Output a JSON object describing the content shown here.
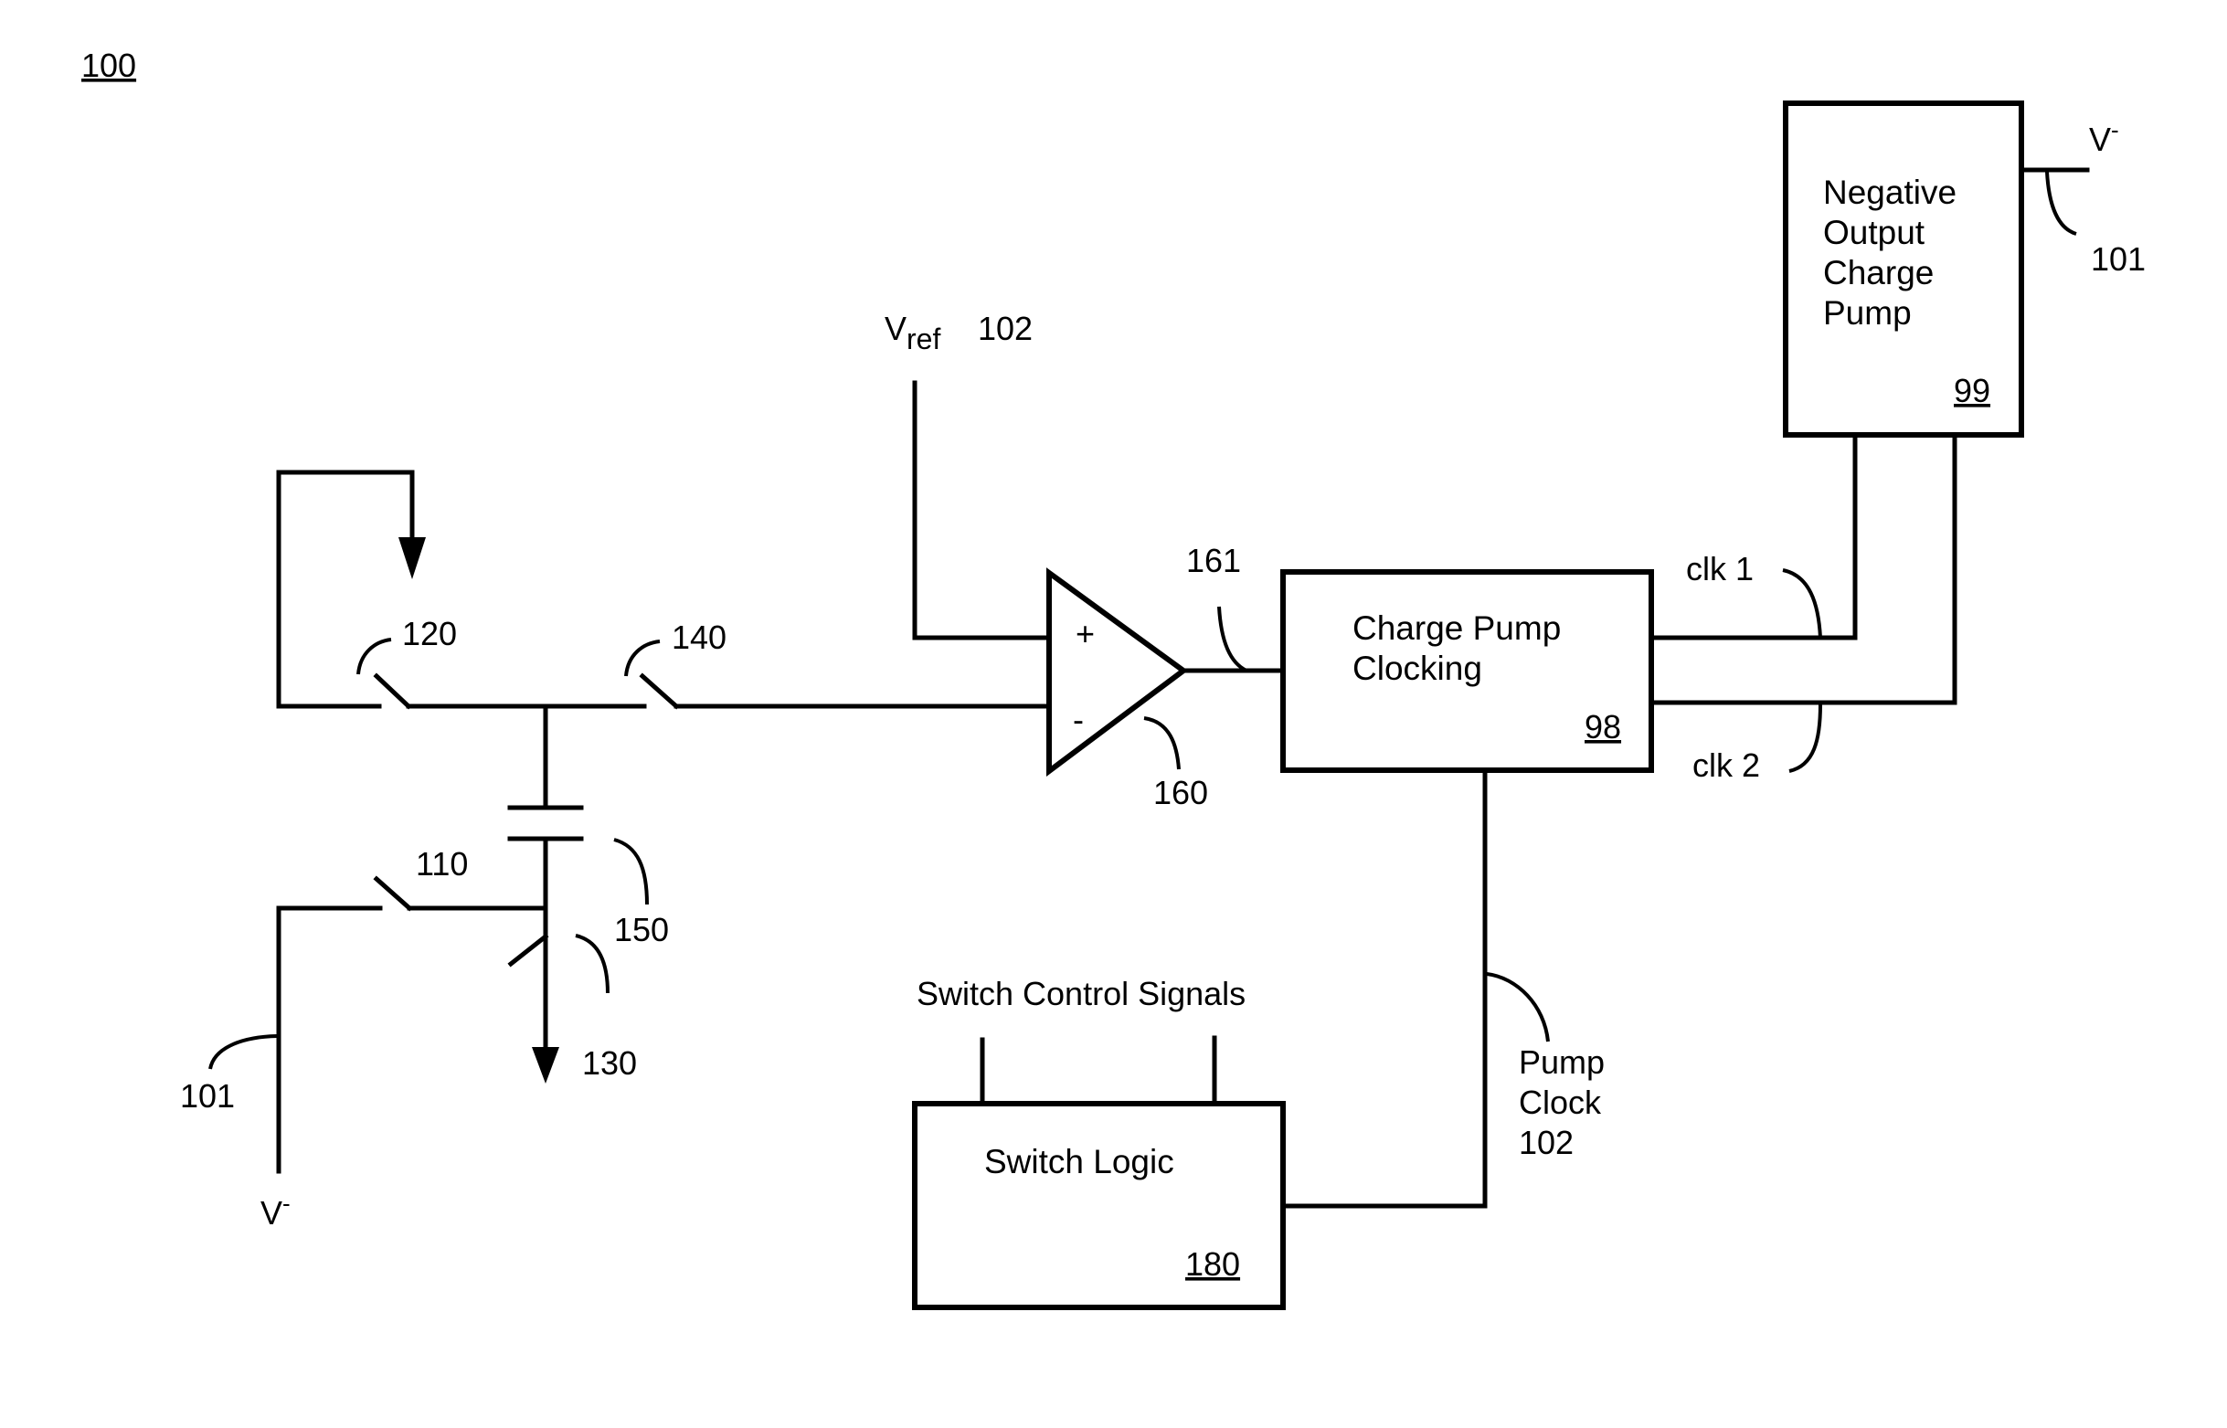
{
  "figure": {
    "ref": "100",
    "nodes": {
      "neg_pump": {
        "lines": [
          "Negative",
          "Output",
          "Charge",
          "Pump"
        ],
        "ref": "99"
      },
      "cp_clocking": {
        "lines": [
          "Charge Pump",
          "Clocking"
        ],
        "ref": "98"
      },
      "switch_logic": {
        "title": "Switch Logic",
        "ref": "180"
      },
      "comparator": {
        "ref": "160",
        "plus": "+",
        "minus": "-",
        "output_ref": "161"
      },
      "capacitor": {
        "ref": "150"
      }
    },
    "switches": [
      {
        "id": "sw120",
        "ref": "120"
      },
      {
        "id": "sw140",
        "ref": "140"
      },
      {
        "id": "sw110",
        "ref": "110"
      },
      {
        "id": "sw130",
        "ref": "130"
      }
    ],
    "labels": {
      "vref_main": "V",
      "vref_sub": "ref",
      "vref_ref": "102",
      "vminus_top": "V",
      "vminus_top_sup": "-",
      "vminus_top_ref": "101",
      "vminus_bottom": "V",
      "vminus_bottom_sup": "-",
      "vminus_bottom_ref": "101",
      "clk1": "clk 1",
      "clk2": "clk 2",
      "switch_control": "Switch Control Signals",
      "pump_clock": [
        "Pump",
        "Clock",
        "102"
      ]
    }
  }
}
